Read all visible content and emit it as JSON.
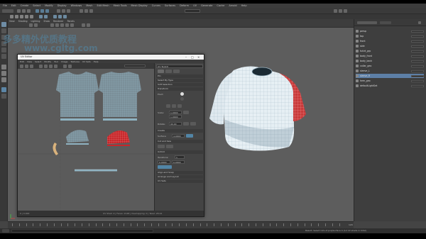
{
  "app": {
    "menu": [
      "File",
      "Edit",
      "Create",
      "Select",
      "Modify",
      "Display",
      "Windows",
      "Mesh",
      "Edit Mesh",
      "Mesh Tools",
      "Mesh Display",
      "Curves",
      "Surfaces",
      "Deform",
      "UV",
      "Generate",
      "Cache",
      "Arnold",
      "Help"
    ],
    "workspace": "General"
  },
  "viewport": {
    "panel_menu": [
      "View",
      "Shading",
      "Lighting",
      "Show",
      "Renderer",
      "Panels"
    ]
  },
  "uv_editor": {
    "title": "UV Editor",
    "menu": [
      "Edit",
      "View",
      "Select",
      "Modify",
      "Tool",
      "Image",
      "Textures",
      "UV Sets",
      "Help"
    ],
    "status_left": "0 | 0.000",
    "status_right": "UV Shell: 4 | Faces: 2148 | Overlapping: 0 | Texel: 28.44",
    "toolkit": {
      "sections": [
        "Pin",
        "Select By Type",
        "Soft Selection",
        "Transform",
        "Create",
        "Cut and Sew",
        "Unfold",
        "Align and Snap",
        "Arrange and Layout",
        "UV Sets"
      ],
      "create_label": "Create",
      "transform_label": "Transform",
      "pivot_label": "Pivot:",
      "scale_label": "Scale:",
      "rotate_label": "Rotate:",
      "unfold_label": "Unfold",
      "iterations_label": "Iterations:",
      "iterations_value": "1",
      "surface_label": "Surface:",
      "scale_value_1": "1.0000",
      "scale_value_2": "1.0000",
      "rotate_value": "90.00",
      "angle_value": "4.0000",
      "unfold_value": "0.0000",
      "layout_value": "0.0000"
    }
  },
  "outliner": {
    "items": [
      {
        "label": "persp",
        "selected": false
      },
      {
        "label": "top",
        "selected": false
      },
      {
        "label": "front",
        "selected": false
      },
      {
        "label": "side",
        "selected": false
      },
      {
        "label": "tshirt_grp",
        "selected": false
      },
      {
        "label": "body_front",
        "selected": false
      },
      {
        "label": "body_back",
        "selected": false
      },
      {
        "label": "collar_geo",
        "selected": false
      },
      {
        "label": "sleeve_L",
        "selected": false
      },
      {
        "label": "sleeve_R",
        "selected": true
      },
      {
        "label": "hem_geo",
        "selected": false
      },
      {
        "label": "defaultLightSet",
        "selected": false
      }
    ]
  },
  "timeline": {
    "start": "1",
    "end": "120",
    "current": "1"
  },
  "command_line": {
    "result": "Result: Select UVs of polySurface 4 (12 UV shells in total)"
  },
  "watermark": {
    "text": "多多精外优质教程",
    "url": "www.cgltg.com"
  },
  "colors": {
    "viewport_bg": "#5d5d5d",
    "uv_shell": "#8fb3c2",
    "uv_selected": "#c8262a",
    "mesh_face": "#e4eef3",
    "sleeve_selected": "#c93a3a"
  }
}
